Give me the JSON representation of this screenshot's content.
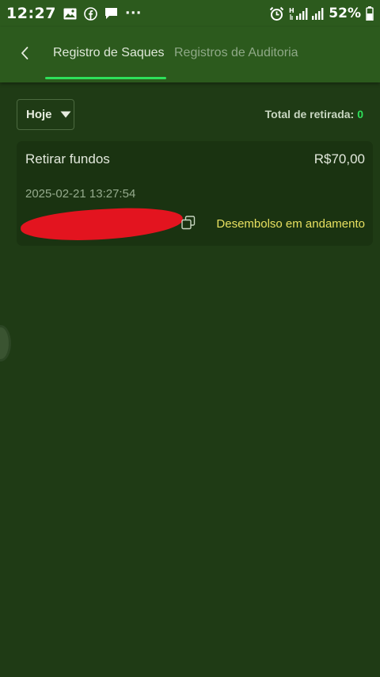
{
  "status_bar": {
    "time": "12:27",
    "battery": "52%",
    "more": "···",
    "icons": [
      "image-icon",
      "facebook-icon",
      "chat-icon",
      "alarm-icon",
      "signal-icon",
      "battery-icon"
    ]
  },
  "header": {
    "back_icon": "chevron-left-icon",
    "tabs": [
      {
        "label": "Registro de Saques",
        "active": true
      },
      {
        "label": "Registros de Auditoria",
        "active": false
      }
    ]
  },
  "filter": {
    "date_label": "Hoje",
    "total_label": "Total de retirada:",
    "total_value": "0"
  },
  "records": [
    {
      "title": "Retirar fundos",
      "amount": "R$70,00",
      "datetime": "2025-02-21 13:27:54",
      "status": "Desembolso em andamento"
    }
  ],
  "colors": {
    "background": "#1f3b15",
    "header": "#2c5a1d",
    "accent": "#2ee05a",
    "status_pending": "#e8e060",
    "redaction": "#e3141f"
  }
}
